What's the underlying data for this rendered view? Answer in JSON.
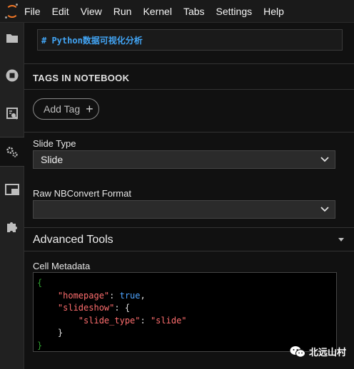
{
  "menubar": {
    "items": [
      "File",
      "Edit",
      "View",
      "Run",
      "Kernel",
      "Tabs",
      "Settings",
      "Help"
    ]
  },
  "sidebar": {
    "icons": [
      {
        "name": "folder-icon"
      },
      {
        "name": "running-icon"
      },
      {
        "name": "commands-icon"
      },
      {
        "name": "property-inspector-icon",
        "active": true
      },
      {
        "name": "tabs-icon"
      },
      {
        "name": "extension-icon"
      }
    ]
  },
  "cell_preview": "# Python数据可视化分析",
  "tags": {
    "heading": "TAGS IN NOTEBOOK",
    "add_label": "Add Tag"
  },
  "slide_type": {
    "label": "Slide Type",
    "value": "Slide"
  },
  "raw_format": {
    "label": "Raw NBConvert Format",
    "value": ""
  },
  "advanced": {
    "title": "Advanced Tools",
    "metadata_label": "Cell Metadata",
    "metadata": {
      "open": "{",
      "homepage_key": "\"homepage\"",
      "homepage_val": "true",
      "slideshow_key": "\"slideshow\"",
      "slide_type_key": "\"slide_type\"",
      "slide_type_val": "\"slide\"",
      "inner_close": "}",
      "close": "}"
    }
  },
  "watermark": "北远山村",
  "colors": {
    "accent_orange": "#f37726",
    "markdown_blue": "#42a5f5",
    "json_key": "#ff6e6e",
    "json_bool": "#4ea4ff",
    "json_brace": "#2e9e2e"
  }
}
